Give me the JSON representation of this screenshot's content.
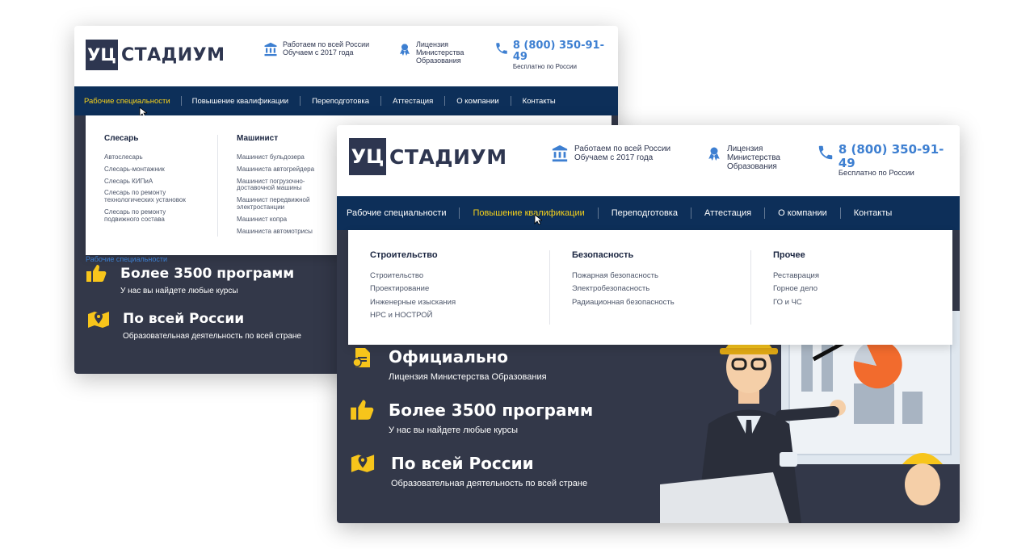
{
  "brand": {
    "logo_box": "УЦ",
    "logo_text": "СТАДИУМ"
  },
  "header": {
    "coverage_line1": "Работаем по всей России",
    "coverage_line2": "Обучаем с 2017 года",
    "license_line1": "Лицензия",
    "license_line2": "Министерства",
    "license_line3": "Образования",
    "phone": "8 (800) 350-91-49",
    "phone_sub": "Бесплатно по России"
  },
  "nav": {
    "items": [
      "Рабочие специальности",
      "Повышение квалификации",
      "Переподготовка",
      "Аттестация",
      "О компании",
      "Контакты"
    ]
  },
  "back_dropdown": {
    "col1_head": "Слесарь",
    "col1": [
      "Автослесарь",
      "Слесарь-монтажник",
      "Слесарь КИПиА",
      "Слесарь по ремонту технологических установок",
      "Слесарь по ремонту подвижного состава"
    ],
    "col2_head": "Машинист",
    "col2": [
      "Машинист бульдозера",
      "Машиниста автогрейдера",
      "Машинист погрузочно-доставочной машины",
      "Машинист передвижной электростанции",
      "Машинист копра",
      "Машиниста автомотрисы"
    ]
  },
  "back_broken_img": "Рабочие специальности",
  "front_dropdown": {
    "col1_head": "Строительство",
    "col1": [
      "Строительство",
      "Проектирование",
      "Инженерные изыскания",
      "НРС и НОСТРОЙ"
    ],
    "col2_head": "Безопасность",
    "col2": [
      "Пожарная безопасность",
      "Электробезопасность",
      "Радиационная безопасность"
    ],
    "col3_head": "Прочее",
    "col3": [
      "Реставрация",
      "Горное дело",
      "ГО и ЧС"
    ]
  },
  "features": {
    "official_title": "Официально",
    "official_sub": "Лицензия Министерства Образования",
    "programs_title": "Более 3500 программ",
    "programs_sub": "У нас вы найдете любые курсы",
    "russia_title": "По всей России",
    "russia_sub": "Образовательная деятельность по всей стране"
  },
  "colors": {
    "navy": "#0d2f59",
    "hero": "#333849",
    "accent_yellow": "#f7d21b",
    "accent_blue": "#3d7fd1",
    "logo": "#2e3650"
  },
  "icons": [
    "bank-icon",
    "award-icon",
    "phone-icon",
    "thumbs-up-icon",
    "map-pin-icon",
    "document-icon",
    "cursor-icon"
  ]
}
